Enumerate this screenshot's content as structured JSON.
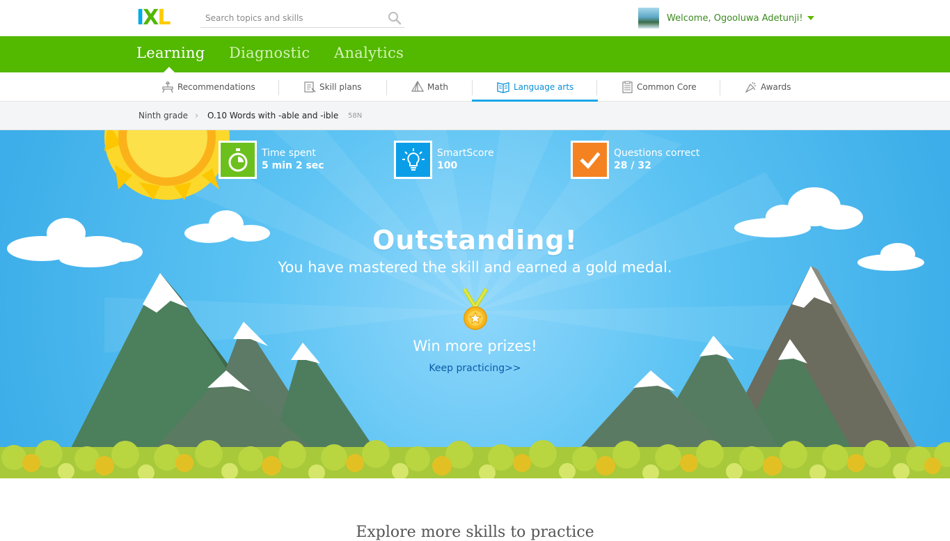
{
  "header": {
    "logo": {
      "letters": [
        "I",
        "X",
        "L"
      ],
      "colors": [
        "#00a9e7",
        "#52b800",
        "#fecb00"
      ]
    },
    "search": {
      "placeholder": "Search topics and skills"
    },
    "user": {
      "welcome": "Welcome, Ogooluwa Adetunji!"
    }
  },
  "main_nav": {
    "tabs": [
      {
        "label": "Learning",
        "active": true
      },
      {
        "label": "Diagnostic",
        "active": false
      },
      {
        "label": "Analytics",
        "active": false
      }
    ]
  },
  "sub_nav": {
    "items": [
      {
        "label": "Recommendations",
        "icon": "recommendations-icon"
      },
      {
        "label": "Skill plans",
        "icon": "skill-plans-icon"
      },
      {
        "label": "Math",
        "icon": "math-icon"
      },
      {
        "label": "Language arts",
        "icon": "language-arts-icon",
        "active": true
      },
      {
        "label": "Common Core",
        "icon": "common-core-icon"
      },
      {
        "label": "Awards",
        "icon": "awards-icon"
      }
    ]
  },
  "breadcrumb": {
    "grade": "Ninth grade",
    "skill": "O.10 Words with -able and -ible",
    "code": "58N"
  },
  "stats": [
    {
      "label": "Time spent",
      "value": "5 min 2 sec",
      "color": "#6cc01e",
      "icon": "stopwatch-icon"
    },
    {
      "label": "SmartScore",
      "value": "100",
      "color": "#0a9ee8",
      "icon": "lightbulb-icon"
    },
    {
      "label": "Questions correct",
      "value": "28 / 32",
      "color": "#f58220",
      "icon": "checkmark-icon"
    }
  ],
  "result": {
    "headline": "Outstanding!",
    "message": "You have mastered the skill and earned a gold medal.",
    "prompt": "Win more prizes!",
    "link": "Keep practicing>>"
  },
  "explore": {
    "heading": "Explore more skills to practice"
  }
}
